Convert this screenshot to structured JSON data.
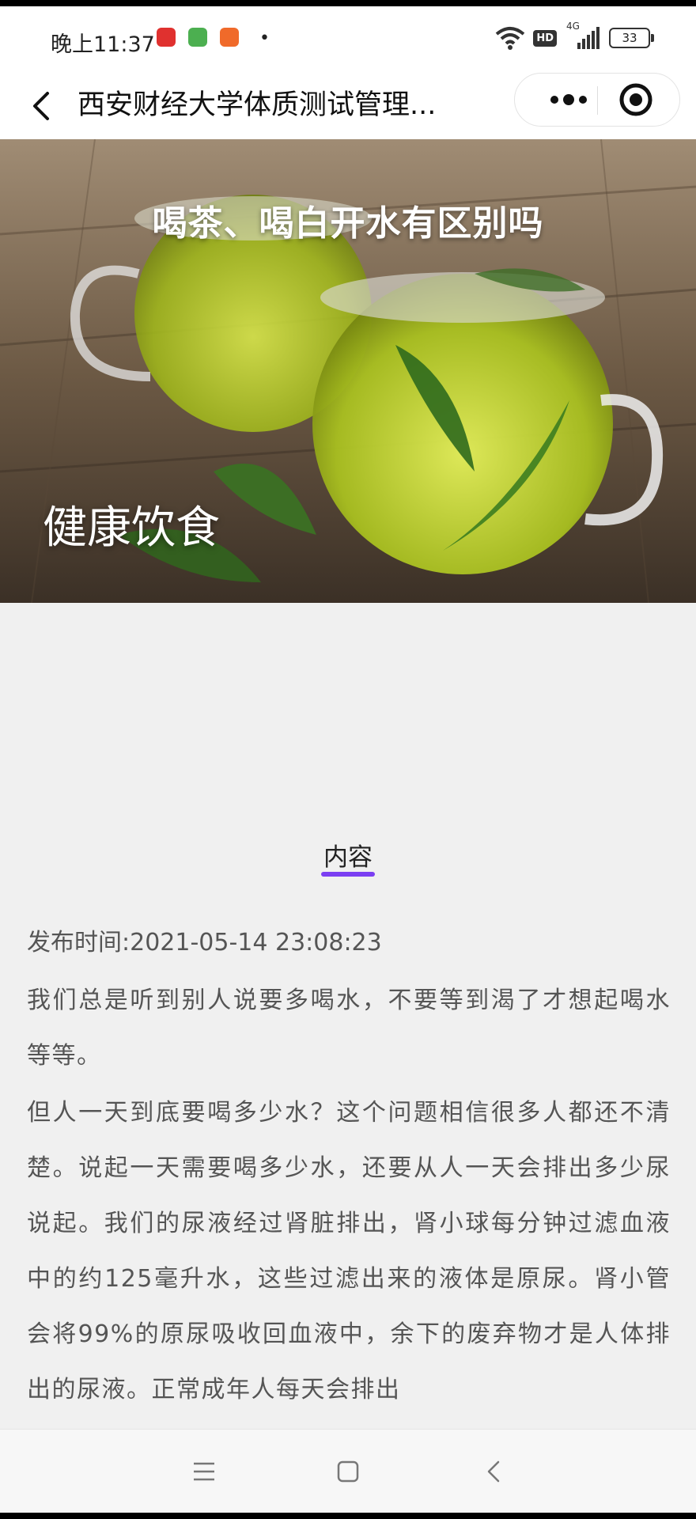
{
  "status_bar": {
    "time": "晚上11:37",
    "dot": "•",
    "hd_label": "HD",
    "network": "4G",
    "battery": "33"
  },
  "nav": {
    "title": "西安财经大学体质测试管理..."
  },
  "banner": {
    "title": "喝茶、喝白开水有区别吗",
    "label": "健康饮食"
  },
  "content": {
    "tab_label": "内容",
    "publish_time": "发布时间:2021-05-14 23:08:23",
    "paragraphs": [
      "我们总是听到别人说要多喝水，不要等到渴了才想起喝水等等。",
      "但人一天到底要喝多少水？这个问题相信很多人都还不清楚。说起一天需要喝多少水，还要从人一天会排出多少尿说起。我们的尿液经过肾脏排出，肾小球每分钟过滤血液中的约125毫升水，这些过滤出来的液体是原尿。肾小管会将99%的原尿吸收回血液中，余下的废弃物才是人体排出的尿液。正常成年人每天会排出"
    ]
  },
  "colors": {
    "accent": "#7b3ff2",
    "background": "#f0f0f0"
  },
  "icons": {
    "back": "back-arrow-icon",
    "more": "more-dots-icon",
    "target": "target-icon",
    "menu": "menu-icon",
    "home": "home-square-icon",
    "nav_back": "nav-back-icon"
  }
}
